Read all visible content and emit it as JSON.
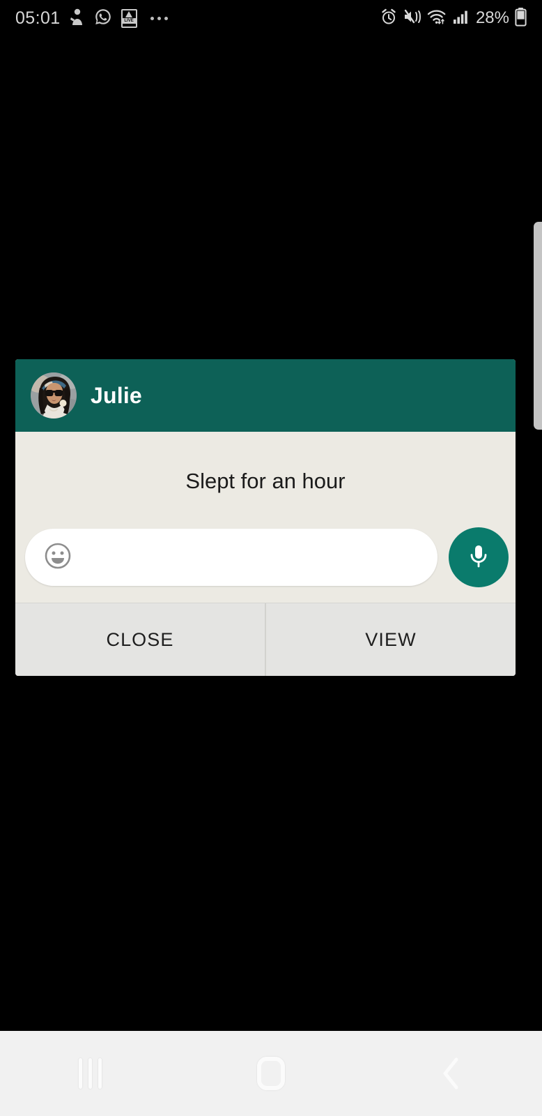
{
  "status_bar": {
    "time": "05:01",
    "battery_percent": "28%",
    "left_icons": [
      {
        "name": "app-notification-icon",
        "label": "app"
      },
      {
        "name": "whatsapp-icon",
        "label": "WhatsApp"
      },
      {
        "name": "abp-live-icon",
        "label": "ABP LIVE"
      },
      {
        "name": "more-notifications-icon",
        "label": "..."
      }
    ],
    "right_icons": [
      {
        "name": "alarm-icon",
        "label": "Alarm set"
      },
      {
        "name": "sound-vibrate-muted-icon",
        "label": "Sound off / vibrate"
      },
      {
        "name": "wifi-icon",
        "label": "Wi-Fi connected"
      },
      {
        "name": "cellular-signal-icon",
        "label": "Signal strength"
      },
      {
        "name": "battery-icon",
        "label": "Battery"
      }
    ]
  },
  "notification": {
    "sender": "Julie",
    "avatar_alt": "Julie profile photo",
    "message": "Slept for an hour",
    "reply": {
      "placeholder": "",
      "value": "",
      "emoji_icon": "emoji-icon",
      "mic_icon": "microphone-icon"
    },
    "actions": [
      {
        "name": "close-button",
        "label": "CLOSE"
      },
      {
        "name": "view-button",
        "label": "VIEW"
      }
    ]
  },
  "nav_bar": {
    "buttons": [
      {
        "name": "nav-recents-button",
        "label": "Recents"
      },
      {
        "name": "nav-home-button",
        "label": "Home"
      },
      {
        "name": "nav-back-button",
        "label": "Back"
      }
    ]
  },
  "colors": {
    "header_teal": "#0d6157",
    "mic_teal": "#0a7b6c",
    "card_body": "#eceae3",
    "action_bar": "#e4e4e2",
    "screen_bg": "#000000",
    "nav_bg": "#f1f1f1"
  }
}
